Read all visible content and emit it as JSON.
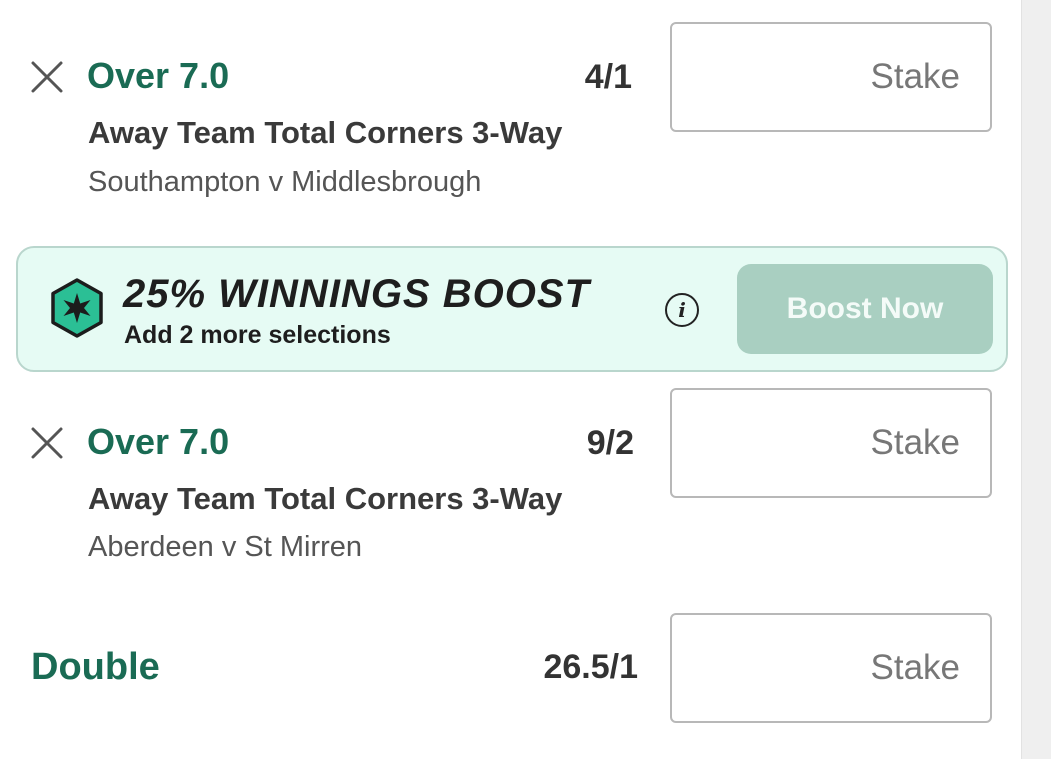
{
  "selections": [
    {
      "selection": "Over 7.0",
      "odds": "4/1",
      "market": "Away Team Total Corners 3-Way",
      "event": "Southampton v Middlesbrough",
      "stake_placeholder": "Stake",
      "remove_icon": "close-icon"
    },
    {
      "selection": "Over 7.0",
      "odds": "9/2",
      "market": "Away Team Total Corners 3-Way",
      "event": "Aberdeen v St Mirren",
      "stake_placeholder": "Stake",
      "remove_icon": "close-icon"
    }
  ],
  "boost": {
    "title": "25% WINNINGS BOOST",
    "subtitle": "Add 2 more selections",
    "info_icon": "info-icon",
    "badge_icon": "star-badge-icon",
    "button_label": "Boost Now"
  },
  "multiples": {
    "label": "Double",
    "odds": "26.5/1",
    "stake_placeholder": "Stake"
  },
  "colors": {
    "accent_green": "#1a6b54",
    "banner_bg": "#e6fbf4",
    "banner_border": "#b9d6cd",
    "boost_button_bg": "#a9cfc1",
    "badge_teal": "#2bbf95"
  }
}
